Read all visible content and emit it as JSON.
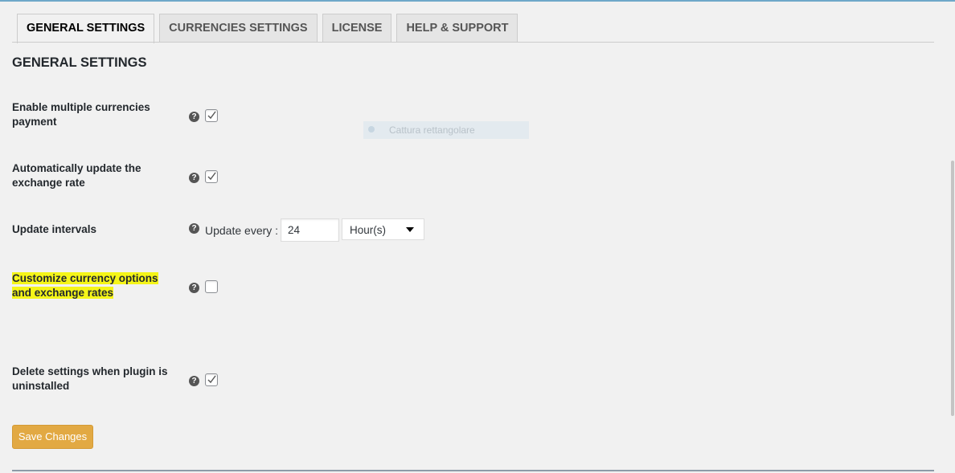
{
  "tabs": [
    {
      "label": "GENERAL SETTINGS",
      "active": true
    },
    {
      "label": "CURRENCIES SETTINGS",
      "active": false
    },
    {
      "label": "LICENSE",
      "active": false
    },
    {
      "label": "HELP & SUPPORT",
      "active": false
    }
  ],
  "section_title": "GENERAL SETTINGS",
  "settings": {
    "multi_currency": {
      "label_line1": "Enable multiple currencies",
      "label_line2": "payment",
      "checked": true
    },
    "auto_update": {
      "label_line1": "Automatically update the",
      "label_line2": "exchange rate",
      "checked": true
    },
    "intervals": {
      "label": "Update intervals",
      "prefix": "Update every :",
      "value": "24",
      "unit_selected": "Hour(s)"
    },
    "customize": {
      "label_line1": "Customize currency options",
      "label_line2": "and exchange rates",
      "checked": false,
      "highlighted": true
    },
    "delete_on_uninstall": {
      "label_line1": "Delete settings when plugin is",
      "label_line2": "uninstalled",
      "checked": true
    }
  },
  "help_glyph": "?",
  "ghost_overlay_text": "Cattura rettangolare",
  "save_label": "Save Changes",
  "colors": {
    "save_button": "#e2a943",
    "highlight": "#f5f519",
    "help_icon": "#555555"
  },
  "icons": [
    "help-icon",
    "checkmark-icon",
    "dropdown-arrow-icon"
  ]
}
